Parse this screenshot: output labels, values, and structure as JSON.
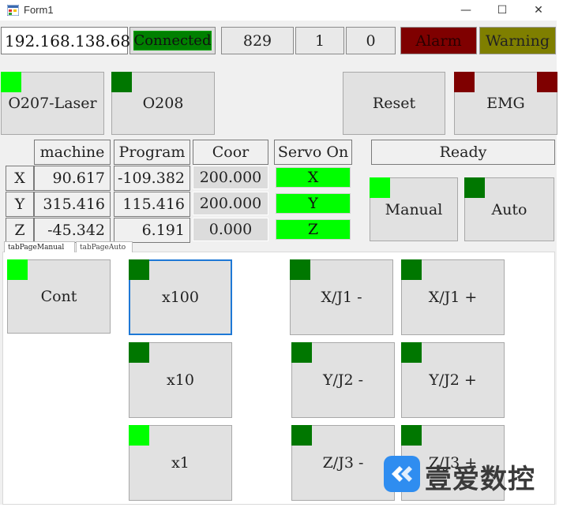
{
  "window": {
    "title": "Form1",
    "minimize": "—",
    "maximize": "☐",
    "close": "✕"
  },
  "status_bar": {
    "ip_address": "192.168.138.68",
    "connection": "Connected",
    "counter1": "829",
    "counter2": "1",
    "counter3": "0",
    "alarm": "Alarm",
    "warning": "Warning"
  },
  "program_buttons": {
    "o207": "O207-Laser",
    "o208": "O208"
  },
  "control_buttons": {
    "reset": "Reset",
    "emg": "EMG"
  },
  "position_table": {
    "headers": {
      "machine": "machine",
      "program": "Program",
      "coor": "Coor",
      "servo": "Servo On"
    },
    "rows": [
      {
        "axis": "X",
        "machine": "90.617",
        "program": "-109.382",
        "coor": "200.000",
        "servo": "X"
      },
      {
        "axis": "Y",
        "machine": "315.416",
        "program": "115.416",
        "coor": "200.000",
        "servo": "Y"
      },
      {
        "axis": "Z",
        "machine": "-45.342",
        "program": "6.191",
        "coor": "0.000",
        "servo": "Z"
      }
    ]
  },
  "ready_status": "Ready",
  "mode_buttons": {
    "manual": "Manual",
    "auto": "Auto"
  },
  "tabs": {
    "manual": "tabPageManual",
    "auto": "tabPageAuto"
  },
  "jog": {
    "cont": "Cont",
    "x100": "x100",
    "x10": "x10",
    "x1": "x1",
    "x_minus": "X/J1 -",
    "x_plus": "X/J1 +",
    "y_minus": "Y/J2 -",
    "y_plus": "Y/J2 +",
    "z_minus": "Z/J3 -",
    "z_plus": "Z/J3 +"
  },
  "watermark": {
    "text": "壹爱数控"
  },
  "colors": {
    "lamp_on": "#00ff00",
    "lamp_off": "#007700",
    "alarm_bg": "#7f0000",
    "warning_bg": "#7f7f00",
    "connected_bg": "#008000",
    "selected_border": "#1e78d6"
  }
}
